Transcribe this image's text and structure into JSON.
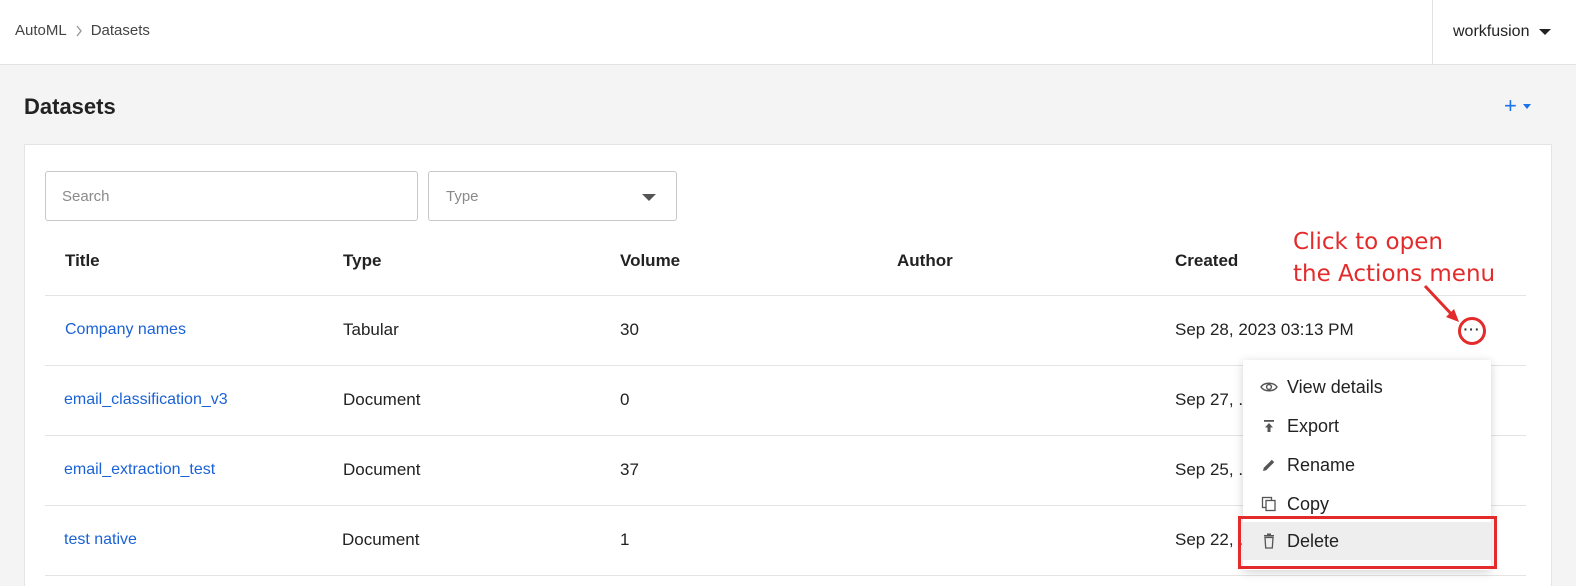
{
  "header": {
    "breadcrumb": [
      "AutoML",
      "Datasets"
    ],
    "user": "workfusion"
  },
  "page": {
    "title": "Datasets",
    "add_label": "+"
  },
  "filters": {
    "search_placeholder": "Search",
    "type_placeholder": "Type"
  },
  "table": {
    "columns": [
      "Title",
      "Type",
      "Volume",
      "Author",
      "Created"
    ],
    "rows": [
      {
        "title": "Company names",
        "type": "Tabular",
        "volume": "30",
        "author": "",
        "created": "Sep 28, 2023 03:13 PM"
      },
      {
        "title": "email_classification_v3",
        "type": "Document",
        "volume": "0",
        "author": "",
        "created": "Sep 27, ."
      },
      {
        "title": "email_extraction_test",
        "type": "Document",
        "volume": "37",
        "author": "",
        "created": "Sep 25, ."
      },
      {
        "title": "test native",
        "type": "Document",
        "volume": "1",
        "author": "",
        "created": "Sep 22, ."
      }
    ]
  },
  "annotation": {
    "line1": "Click to open",
    "line2": "the Actions menu",
    "color": "#e32b2b"
  },
  "actions_menu": {
    "items": [
      {
        "label": "View details",
        "icon": "eye-icon"
      },
      {
        "label": "Export",
        "icon": "export-icon"
      },
      {
        "label": "Rename",
        "icon": "pencil-icon"
      },
      {
        "label": "Copy",
        "icon": "copy-icon"
      },
      {
        "label": "Delete",
        "icon": "trash-icon"
      }
    ]
  },
  "colors": {
    "link": "#1a62d6",
    "accent": "#1a73e8"
  }
}
